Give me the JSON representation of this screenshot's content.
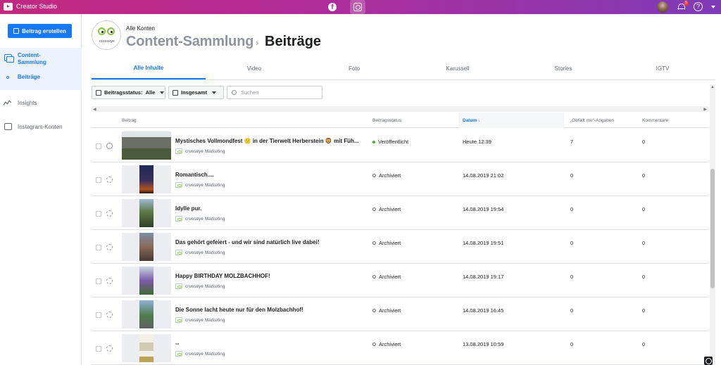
{
  "app": {
    "title": "Creator Studio",
    "notifications": "5",
    "help": "?"
  },
  "sidebar": {
    "create_label": "Beitrag erstellen",
    "items": [
      {
        "label": "Content-Sammlung"
      },
      {
        "label": "Beiträge"
      },
      {
        "label": "Insights"
      },
      {
        "label": "Instagram-Konten"
      }
    ]
  },
  "header": {
    "account_scope": "Alle Konten",
    "brand_label": "crosseye",
    "crumb_parent": "Content-Sammlung",
    "crumb_separator": "›",
    "crumb_current": "Beiträge"
  },
  "tabs": [
    {
      "label": "Alle Inhalte"
    },
    {
      "label": "Video"
    },
    {
      "label": "Foto"
    },
    {
      "label": "Karussell"
    },
    {
      "label": "Stories"
    },
    {
      "label": "IGTV"
    }
  ],
  "filters": {
    "status_label": "Beitragsstatus:",
    "status_value": "Alle",
    "period_label": "Insgesamt",
    "search_placeholder": "Suchen"
  },
  "table": {
    "columns": [
      "Beitrag",
      "Beitragsstatus",
      "Datum ↓",
      "„Gefällt mir“-Angaben",
      "Kommentare"
    ],
    "rows": [
      {
        "title": "Mystisches Vollmondfest 🙂 in der Tierwelt Herberstein 🦁 mit Füh...",
        "account": "crosseye Marketing",
        "status": "Veröffentlicht",
        "date": "Heute 12:39",
        "likes": "7",
        "comments": "0"
      },
      {
        "title": "Romantisch....",
        "account": "crosseye Marketing",
        "status": "Archiviert",
        "date": "14.08.2019 21:02",
        "likes": "0",
        "comments": "0"
      },
      {
        "title": "Idylle pur.",
        "account": "crosseye Marketing",
        "status": "Archiviert",
        "date": "14.08.2019 19:54",
        "likes": "0",
        "comments": "0"
      },
      {
        "title": "Das gehört gefeiert - und wir sind natürlich live dabei!",
        "account": "crosseye Marketing",
        "status": "Archiviert",
        "date": "14.08.2019 19:51",
        "likes": "0",
        "comments": "0"
      },
      {
        "title": "Happy BIRTHDAY MOLZBACHHOF!",
        "account": "crosseye Marketing",
        "status": "Archiviert",
        "date": "14.08.2019 19:17",
        "likes": "0",
        "comments": "0"
      },
      {
        "title": "Die Sonne lacht heute nur für den Molzbachhof!",
        "account": "crosseye Marketing",
        "status": "Archiviert",
        "date": "14.08.2019 16:45",
        "likes": "0",
        "comments": "0"
      },
      {
        "title": "--",
        "account": "crosseye Marketing",
        "status": "Archiviert",
        "date": "13.08.2019 10:59",
        "likes": "0",
        "comments": "0"
      }
    ]
  },
  "colors": {
    "accent": "#1877f2",
    "published": "#42b72a",
    "gradient_start": "#c2297f",
    "gradient_end": "#7e3bb7"
  }
}
